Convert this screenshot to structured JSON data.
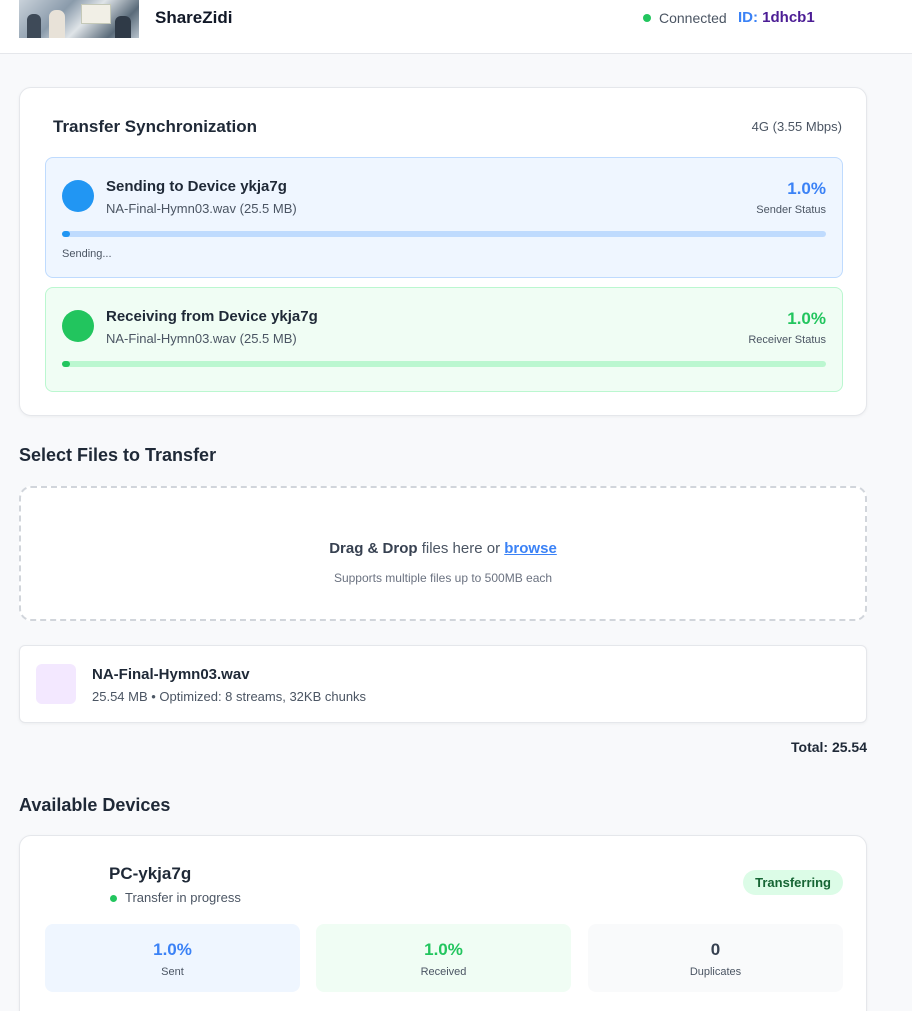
{
  "header": {
    "app_title": "ShareZidi",
    "connection_status": "Connected",
    "id_label": "ID:",
    "id_value": "1dhcb1"
  },
  "sync": {
    "title": "Transfer Synchronization",
    "network": "4G (3.55 Mbps)",
    "sender": {
      "title": "Sending to Device ykja7g",
      "file": "NA-Final-Hymn03.wav (25.5 MB)",
      "percent_text": "1.0%",
      "progress_fraction": 0.01,
      "role": "Sender Status",
      "note": "Sending..."
    },
    "receiver": {
      "title": "Receiving from Device ykja7g",
      "file": "NA-Final-Hymn03.wav (25.5 MB)",
      "percent_text": "1.0%",
      "progress_fraction": 0.01,
      "role": "Receiver Status"
    }
  },
  "select_files": {
    "title": "Select Files to Transfer",
    "drop_bold": "Drag & Drop",
    "drop_middle": " files here or ",
    "browse": "browse",
    "drop_sub": "Supports multiple files up to 500MB each"
  },
  "files": [
    {
      "name": "NA-Final-Hymn03.wav",
      "meta": "25.54 MB • Optimized: 8 streams, 32KB chunks"
    }
  ],
  "total": "Total: 25.54",
  "devices": {
    "title": "Available Devices",
    "items": [
      {
        "name": "PC-ykja7g",
        "status": "Transfer in progress",
        "badge": "Transferring",
        "stats": {
          "sent_value": "1.0%",
          "sent_label": "Sent",
          "received_value": "1.0%",
          "received_label": "Received",
          "duplicates_value": "0",
          "duplicates_label": "Duplicates"
        }
      }
    ]
  },
  "colors": {
    "accent_blue": "#2196f3",
    "accent_green": "#22c55e",
    "id_value": "#4c1d95"
  }
}
